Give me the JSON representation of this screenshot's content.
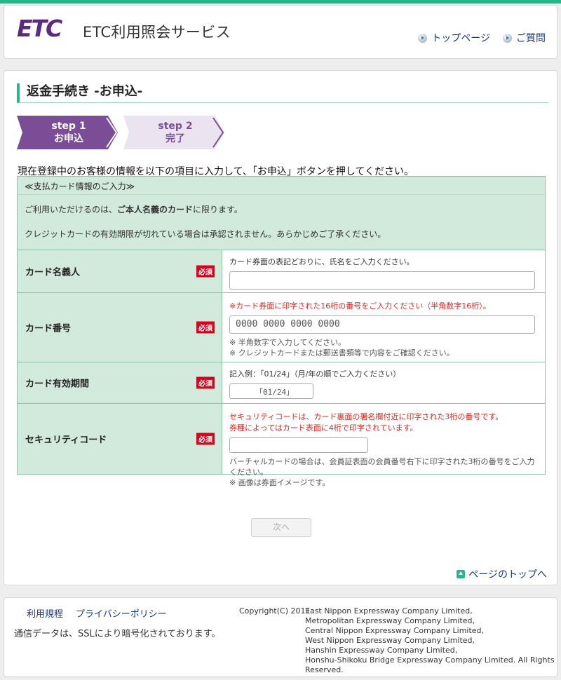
{
  "header": {
    "logo_text": "ETC",
    "site_title": "ETC利用照会サービス",
    "nav": [
      "トップページ",
      "ご質問"
    ]
  },
  "page": {
    "title": "返金手続き -お申込-",
    "steps": [
      {
        "num": "step 1",
        "label": "お申込"
      },
      {
        "num": "step 2",
        "label": "完了"
      }
    ],
    "instruction": "現在登録中のお客様の情報を以下の項目に入力して、「お申込」ボタンを押してください。"
  },
  "form": {
    "section_title": "≪支払カード情報のご入力≫",
    "info_1_prefix": "ご利用いただけるのは、",
    "info_1_bold": "ご本人名義のカード",
    "info_1_suffix": "に限ります。",
    "info_2": "クレジットカードの有効期限が切れている場合は承認されません。あらかじめご了承ください。",
    "required_badge": "必須",
    "card_name": {
      "label": "カード名義人",
      "hint": "カード券面の表記どおりに、氏名をご入力ください。",
      "value": ""
    },
    "card_number": {
      "label": "カード番号",
      "hint_red": "※カード券面に印字された16桁の番号をご入力ください（半角数字16桁）。",
      "placeholder": "0000 0000 0000 0000",
      "note_1": "※ 半角数字で入力してください。",
      "note_2": "※ クレジットカードまたは郵送書類等で内容をご確認ください。"
    },
    "expiry": {
      "label": "カード有効期間",
      "hint": "記入例：「01/24」（月/年の順でご入力ください）",
      "placeholder": "「01/24」"
    },
    "security": {
      "label": "セキュリティコード",
      "hint_red_1": "セキュリティコードは、カード裏面の署名欄付近に印字された3桁の番号です。",
      "hint_red_2": "券種によってはカード表面に4桁で印字されています。",
      "note_1": "バーチャルカードの場合は、会員証表面の会員番号右下に印字された3桁の番号をご入力ください。",
      "note_2": "※ 画像は券面イメージです。"
    },
    "next_button": "次へ"
  },
  "pagetop": "ページのトップへ",
  "footer": {
    "links": [
      "利用規程",
      "プライバシーポリシー"
    ],
    "ssl_note": "通信データは、SSLにより暗号化されております。",
    "copyright_label": "Copyright(C) 2011",
    "companies": [
      "East Nippon Expressway Company Limited,",
      "Metropolitan Expressway Company Limited,",
      "Central Nippon Expressway Company Limited,",
      "West Nippon Expressway Company Limited,",
      "Hanshin Expressway Company Limited,",
      "Honshu-Shikoku Bridge Expressway Company Limited. All Rights Reserved."
    ]
  },
  "colors": {
    "accent": "#2db38a",
    "step_active": "#7a4d96",
    "step_inactive": "#ece3f1",
    "form_bg": "#d2eadb",
    "required": "#d9001b",
    "link": "#1a3a7a"
  }
}
